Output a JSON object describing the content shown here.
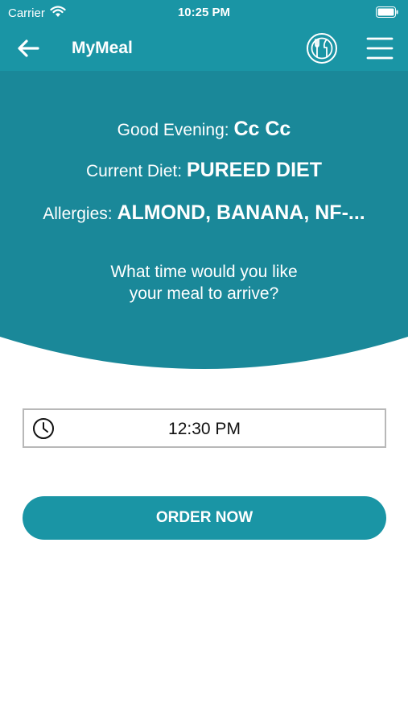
{
  "status_bar": {
    "carrier": "Carrier",
    "time": "10:25 PM",
    "icons": [
      "wifi-icon",
      "battery-icon"
    ]
  },
  "nav": {
    "title": "MyMeal",
    "icons": [
      "back-arrow-icon",
      "meal-plate-icon",
      "hamburger-menu-icon"
    ]
  },
  "greeting": {
    "label": "Good Evening: ",
    "name": "Cc Cc"
  },
  "diet": {
    "label": "Current Diet: ",
    "value": "PUREED DIET"
  },
  "allergies": {
    "label": "Allergies: ",
    "value": "ALMOND, BANANA, NF-..."
  },
  "question": {
    "line1": "What time would you like",
    "line2": "your meal to arrive?"
  },
  "time_picker": {
    "value": "12:30 PM",
    "icon": "clock-icon"
  },
  "order_button": {
    "label": "ORDER NOW"
  },
  "colors": {
    "primary": "#1a95a5",
    "hero": "#1a8899",
    "white": "#ffffff"
  }
}
